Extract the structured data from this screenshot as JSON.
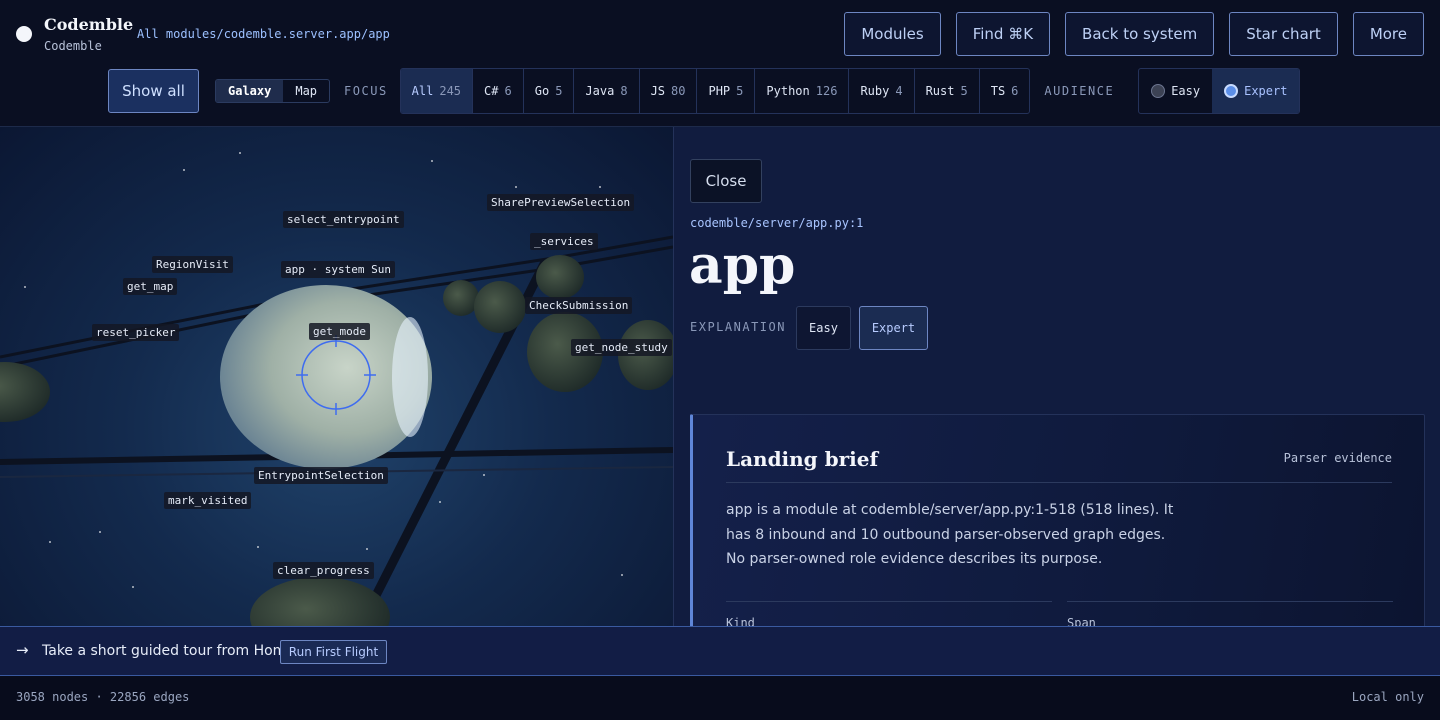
{
  "brand": {
    "name": "Codemble",
    "sub": "Codemble"
  },
  "breadcrumb": "All modules/codemble.server.app/app",
  "top_buttons": {
    "modules": "Modules",
    "find": "Find ⌘K",
    "back": "Back to system",
    "star": "Star chart",
    "more": "More"
  },
  "toolbar": {
    "show_all": "Show all",
    "view_modes": [
      "Galaxy",
      "Map"
    ],
    "focus_label": "FOCUS",
    "focus": [
      {
        "label": "All",
        "count": "245"
      },
      {
        "label": "C#",
        "count": "6"
      },
      {
        "label": "Go",
        "count": "5"
      },
      {
        "label": "Java",
        "count": "8"
      },
      {
        "label": "JS",
        "count": "80"
      },
      {
        "label": "PHP",
        "count": "5"
      },
      {
        "label": "Python",
        "count": "126"
      },
      {
        "label": "Ruby",
        "count": "4"
      },
      {
        "label": "Rust",
        "count": "5"
      },
      {
        "label": "TS",
        "count": "6"
      }
    ],
    "audience_label": "AUDIENCE",
    "audience": [
      "Easy",
      "Expert"
    ]
  },
  "galaxy_labels": {
    "share_preview": "SharePreviewSelection",
    "select_entry": "select_entrypoint",
    "services": "_services",
    "region_visit": "RegionVisit",
    "sun": "app · system Sun",
    "get_map": "get_map",
    "check_sub": "CheckSubmission",
    "reset_picker": "reset_picker",
    "get_mode": "get_mode",
    "get_node_study": "get_node_study",
    "entry_sel": "EntrypointSelection",
    "mark_visited": "mark_visited",
    "clear_progress": "clear_progress"
  },
  "panel": {
    "close": "Close",
    "path": "codemble/server/app.py:1",
    "title": "app",
    "explanation_label": "EXPLANATION",
    "explanation_modes": [
      "Easy",
      "Expert"
    ],
    "brief": {
      "title": "Landing brief",
      "tag": "Parser evidence",
      "text": "app is a module at codemble/server/app.py:1-518 (518 lines). It has 8 inbound and 10 outbound parser-observed graph edges. No parser-owned role evidence describes its purpose.",
      "kind_label": "Kind",
      "span_label": "Span"
    }
  },
  "tour": {
    "arrow": "→",
    "text": "Take a short guided tour from Home.",
    "button": "Run First Flight"
  },
  "footer": {
    "stats": "3058 nodes · 22856 edges",
    "local": "Local only"
  }
}
